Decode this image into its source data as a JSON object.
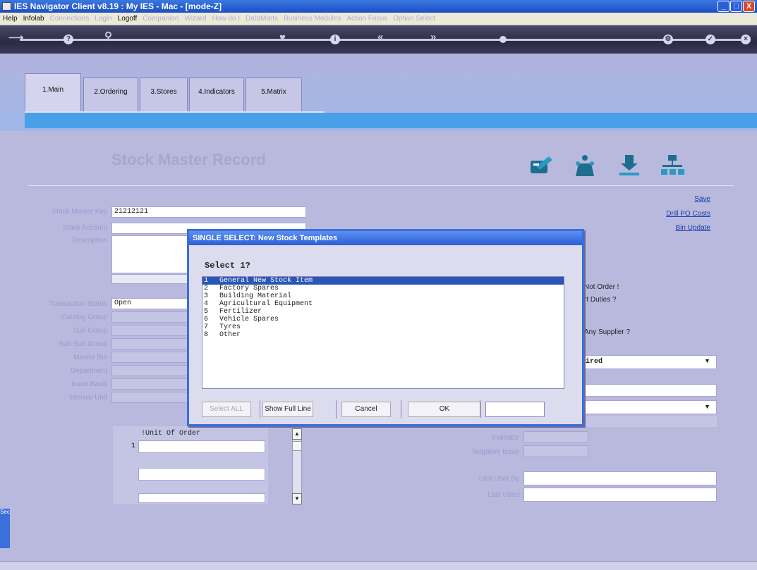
{
  "window": {
    "title": "IES Navigator Client v8.19 : My IES - Mac -      [mode-Z]",
    "minimize": "_",
    "maximize": "□",
    "close": "X"
  },
  "menu": [
    {
      "label": "Help",
      "active": true
    },
    {
      "label": "Infolab",
      "active": true
    },
    {
      "label": "Connections",
      "active": false
    },
    {
      "label": "Login",
      "active": false
    },
    {
      "label": "Logoff",
      "active": true
    },
    {
      "label": "Companion",
      "active": false
    },
    {
      "label": "Wizard",
      "active": false
    },
    {
      "label": "How do I",
      "active": false
    },
    {
      "label": "DataMarts",
      "active": false
    },
    {
      "label": "Business Modules",
      "active": false
    },
    {
      "label": "Action Focus",
      "active": false
    },
    {
      "label": "Option Select",
      "active": false
    }
  ],
  "toolbar": {
    "help": "?",
    "search_icon": "search-icon",
    "heart_icon": "heart-icon",
    "back": "«",
    "forward": "»",
    "settings_icon": "gear-icon",
    "ok_icon": "check-icon",
    "close_icon": "close-icon"
  },
  "tabs": [
    {
      "label": "1.Main"
    },
    {
      "label": "2.Ordering"
    },
    {
      "label": "3.Stores"
    },
    {
      "label": "4.Indicators"
    },
    {
      "label": "5.Matrix"
    }
  ],
  "page": {
    "title": "Stock Master Record",
    "links": {
      "save": "Save",
      "drill_po_costs": "Drill PO Costs",
      "bin_update": "Bin Update"
    },
    "fields": {
      "stock_master_key_label": "Stock Master Key",
      "stock_master_key_value": "21212121",
      "stock_account_label": "Stock Account",
      "description_label": "Description",
      "transaction_status_label": "Transaction Status",
      "transaction_status_value": "Open",
      "catalog_group_label": "Catalog Group",
      "sub_group_label": "Sub Group",
      "sub_sub_group_label": "Sub Sub Group",
      "master_bin_label": "Master Bin",
      "department_label": "Department",
      "issue_basis_label": "Issue Basis",
      "internal_unit_label": "Internal Unit",
      "unit_of_order_header": "!Unit Of Order",
      "unit_row_1": "1",
      "indicator_label": "Indicator",
      "negative_issue_label": "Negative Issue",
      "last_user_label": "Last User By",
      "last_used_label": "Last Used",
      "right_not_order": "Not Order !",
      "right_duties": "rt Duties ?",
      "right_supplier": "Any Supplier ?",
      "right_select_value": "ired"
    }
  },
  "modal": {
    "title": "SINGLE SELECT:  New Stock Templates",
    "prompt": "Select 1?",
    "items": [
      {
        "num": "1",
        "label": "General New Stock Item",
        "selected": true
      },
      {
        "num": "2",
        "label": "Factory Spares",
        "selected": false
      },
      {
        "num": "3",
        "label": "Building Material",
        "selected": false
      },
      {
        "num": "4",
        "label": "Agricultural Equipment",
        "selected": false
      },
      {
        "num": "5",
        "label": "Fertilizer",
        "selected": false
      },
      {
        "num": "6",
        "label": "Vehicle Spares",
        "selected": false
      },
      {
        "num": "7",
        "label": "Tyres",
        "selected": false
      },
      {
        "num": "8",
        "label": "Other",
        "selected": false
      }
    ],
    "buttons": {
      "select_all": "Select ALL",
      "show_full_line": "Show Full Line",
      "cancel": "Cancel",
      "ok": "OK"
    },
    "input_value": ""
  },
  "side_tab": "Sec"
}
